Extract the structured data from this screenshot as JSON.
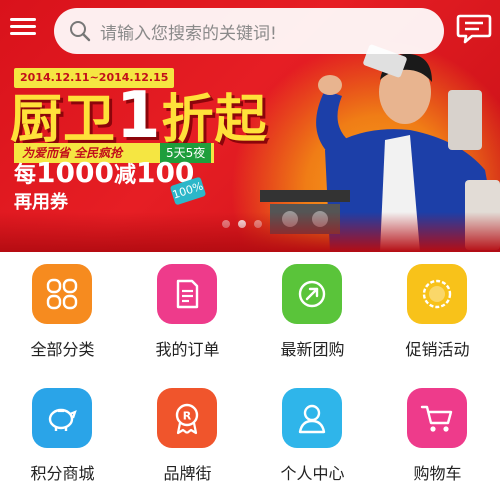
{
  "search": {
    "placeholder": "请输入您搜索的关键词!"
  },
  "banner": {
    "date_range": "2014.12.11~2014.12.15",
    "headline_a": "厨卫",
    "headline_num": "1",
    "headline_b": "折起",
    "slogan": "为爱而省  全民疯抢",
    "tag": "5天5夜",
    "promo_a": "每",
    "promo_num1": "1000",
    "promo_b": "减",
    "promo_num2": "100",
    "promo_line2": "再用券",
    "badge": "100%",
    "slides_count": 3,
    "active_slide": 2
  },
  "grid": [
    {
      "label": "全部分类",
      "icon": "category-grid-icon",
      "color": "#f68b1f"
    },
    {
      "label": "我的订单",
      "icon": "order-doc-icon",
      "color": "#ee3b8b"
    },
    {
      "label": "最新团购",
      "icon": "group-buy-arrow-icon",
      "color": "#5ac43a"
    },
    {
      "label": "促销活动",
      "icon": "sale-tag-icon",
      "color": "#f8c21a"
    },
    {
      "label": "积分商城",
      "icon": "piggy-bank-icon",
      "color": "#2aa4e8"
    },
    {
      "label": "品牌街",
      "icon": "brand-ribbon-icon",
      "color": "#f0552c"
    },
    {
      "label": "个人中心",
      "icon": "person-icon",
      "color": "#2fb5ea"
    },
    {
      "label": "购物车",
      "icon": "cart-icon",
      "color": "#ee3b8b"
    }
  ]
}
